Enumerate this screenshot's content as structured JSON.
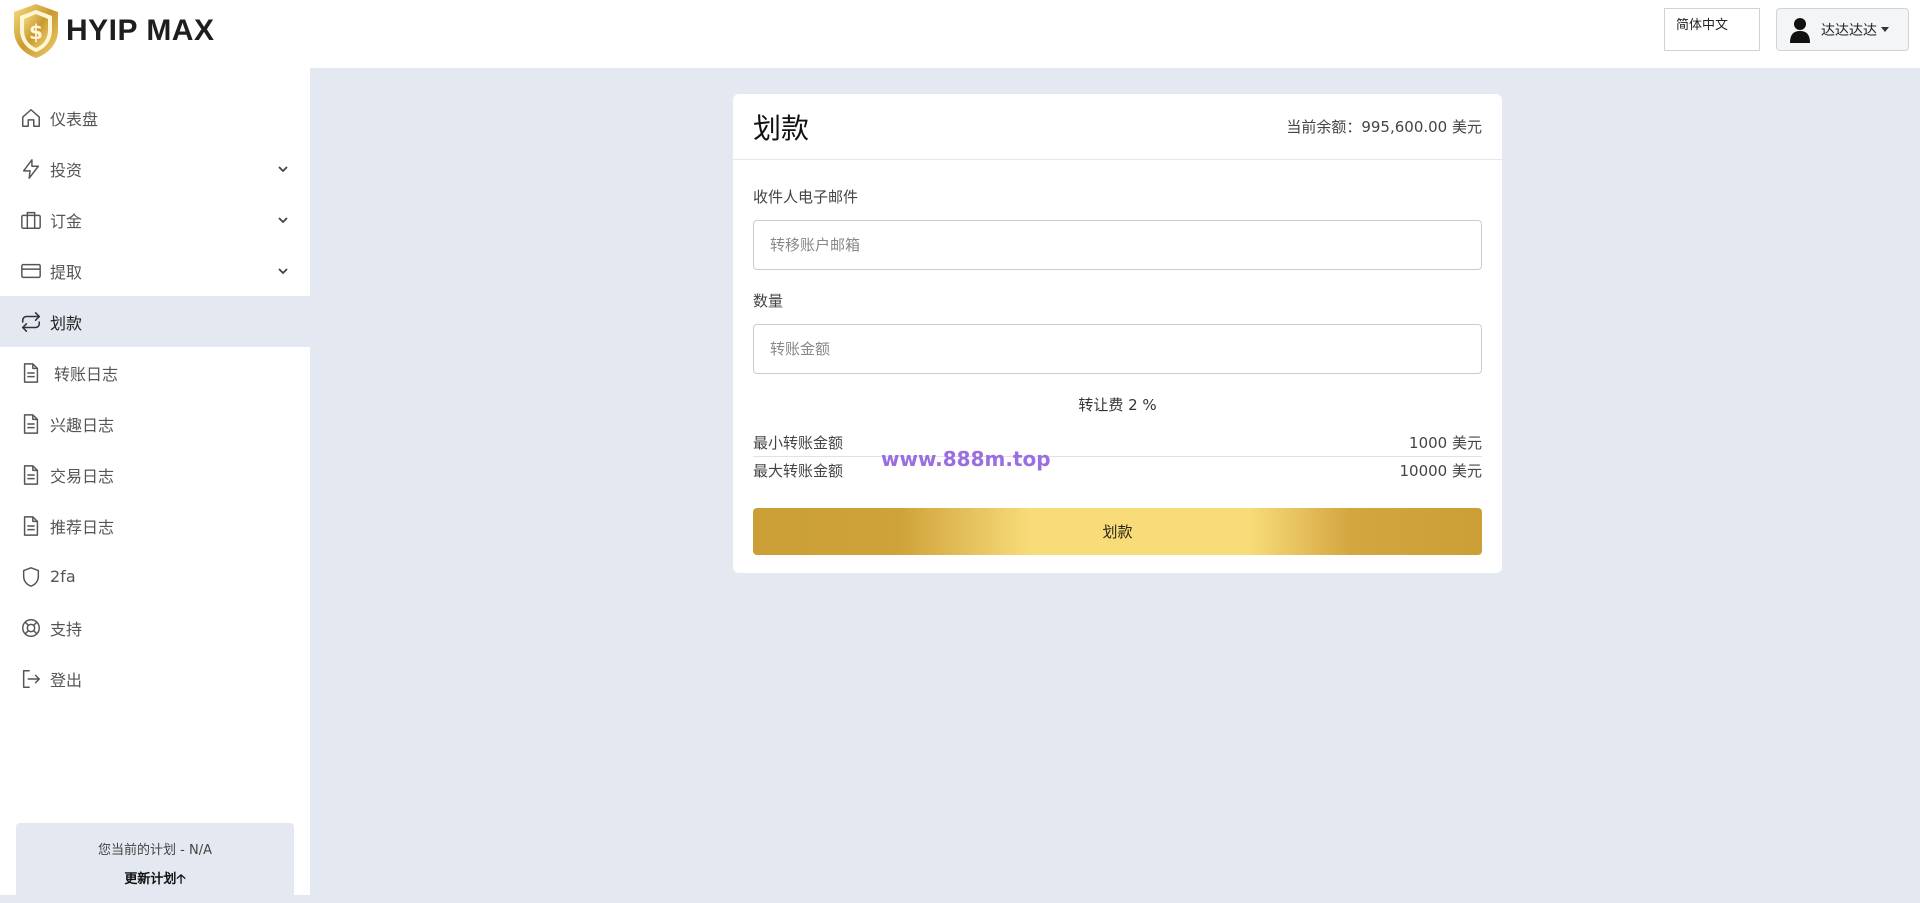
{
  "header": {
    "brand_name": "HYIP MAX",
    "language": "简体中文",
    "username": "达达达达"
  },
  "sidebar": {
    "items": [
      {
        "label": "仪表盘",
        "icon": "home-icon"
      },
      {
        "label": "投资",
        "icon": "lightning-icon",
        "expandable": true
      },
      {
        "label": "订金",
        "icon": "briefcase-icon",
        "expandable": true
      },
      {
        "label": "提取",
        "icon": "credit-card-icon",
        "expandable": true
      },
      {
        "label": "划款",
        "icon": "transfer-icon",
        "active": true
      },
      {
        "label": "转账日志",
        "icon": "document-icon"
      },
      {
        "label": "兴趣日志",
        "icon": "document-icon"
      },
      {
        "label": "交易日志",
        "icon": "document-icon"
      },
      {
        "label": "推荐日志",
        "icon": "document-icon"
      },
      {
        "label": "2fa",
        "icon": "shield-icon"
      },
      {
        "label": "支持",
        "icon": "lifebuoy-icon"
      },
      {
        "label": "登出",
        "icon": "logout-icon"
      }
    ],
    "plan": {
      "text": "您当前的计划 - N/A",
      "upgrade_label": "更新计划"
    }
  },
  "transfer": {
    "title": "划款",
    "balance": "当前余额：995,600.00 美元",
    "email_label": "收件人电子邮件",
    "email_placeholder": "转移账户邮箱",
    "amount_label": "数量",
    "amount_placeholder": "转账金额",
    "fee_text": "转让费 2 %",
    "min_label": "最小转账金额",
    "min_value": "1000 美元",
    "max_label": "最大转账金额",
    "max_value": "10000 美元",
    "submit_label": "划款"
  },
  "watermark": "www.888m.top",
  "colors": {
    "accent_gold": "#cb9e36",
    "accent_gold_light": "#f7dc79",
    "page_bg": "#e4e8f0",
    "watermark": "#9a6ee0"
  }
}
